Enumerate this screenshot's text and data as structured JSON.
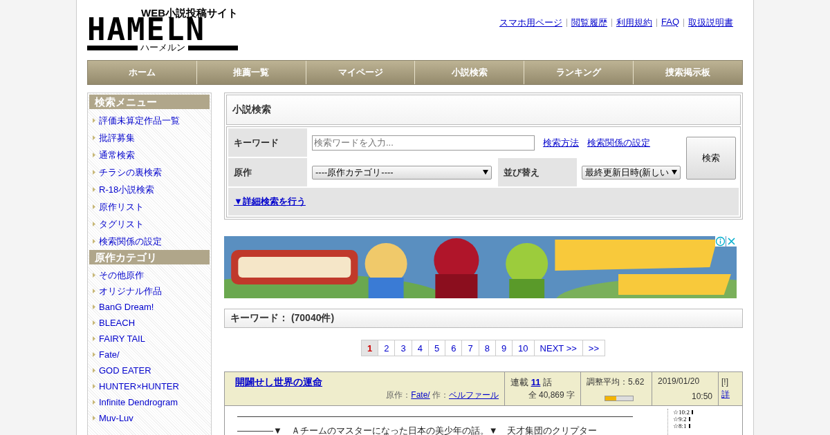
{
  "logo": {
    "tagline": "WEB小説投稿サイト",
    "wordmark": "HAMELN",
    "reading": "ハーメルン"
  },
  "header_links": [
    "スマホ用ページ",
    "閲覧履歴",
    "利用規約",
    "FAQ",
    "取扱説明書"
  ],
  "nav": [
    {
      "label": "ホーム",
      "selected": false
    },
    {
      "label": "推薦一覧",
      "selected": false
    },
    {
      "label": "マイページ",
      "selected": false
    },
    {
      "label": "小説検索",
      "selected": false
    },
    {
      "label": "ランキング",
      "selected": false
    },
    {
      "label": "捜索掲示板",
      "selected": false
    }
  ],
  "sidebar": [
    {
      "title": "検索メニュー",
      "items": [
        "評価未算定作品一覧",
        "批評募集",
        "通常検索",
        "チラシの裏検索",
        "R-18小説検索",
        "原作リスト",
        "タグリスト",
        "検索関係の設定"
      ]
    },
    {
      "title": "原作カテゴリ",
      "items": [
        "その他原作",
        "オリジナル作品",
        "BanG Dream!",
        "BLEACH",
        "FAIRY TAIL",
        "Fate/",
        "GOD EATER",
        "HUNTER×HUNTER",
        "Infinite Dendrogram",
        "Muv-Luv"
      ]
    }
  ],
  "search": {
    "title": "小説検索",
    "keyword_label": "キーワード",
    "keyword_placeholder": "検索ワードを入力...",
    "links": [
      "検索方法",
      "検索関係の設定"
    ],
    "source_label": "原作",
    "source_value": "----原作カテゴリ----",
    "sort_label": "並び替え",
    "sort_value": "最終更新日時(新しい",
    "submit": "検索",
    "advanced": "▼詳細検索を行う"
  },
  "ad": {
    "kind": "picture"
  },
  "results_header": "キーワード： (70040件)",
  "pagination": [
    {
      "label": "1",
      "selected": true
    },
    {
      "label": "2",
      "selected": false
    },
    {
      "label": "3",
      "selected": false
    },
    {
      "label": "4",
      "selected": false
    },
    {
      "label": "5",
      "selected": false
    },
    {
      "label": "6",
      "selected": false
    },
    {
      "label": "7",
      "selected": false
    },
    {
      "label": "8",
      "selected": false
    },
    {
      "label": "9",
      "selected": false
    },
    {
      "label": "10",
      "selected": false
    },
    {
      "label": "NEXT >>",
      "selected": false
    },
    {
      "label": ">>",
      "selected": false
    }
  ],
  "result": {
    "title": "開闢せし世界の運命",
    "source_prefix": "原作：",
    "source": "Fate/",
    "author_prefix": "作：",
    "author": "ベルファール",
    "serial_prefix": "連載",
    "episodes": "11",
    "serial_suffix": "話",
    "chars": "全 40,869 字",
    "rating": "調整平均：5.62",
    "level": 0.4,
    "date": "2019/01/20",
    "time": "10:50",
    "flag": "[!]",
    "detail": "詳",
    "summary": [
      "————————————————————————————————————————————",
      "————▼　Ａチームのマスターになった日本の美少年の話。▼　天才集団のクリプター"
    ],
    "votes": [
      "☆10:2",
      "☆9:2",
      "☆8:1"
    ]
  }
}
